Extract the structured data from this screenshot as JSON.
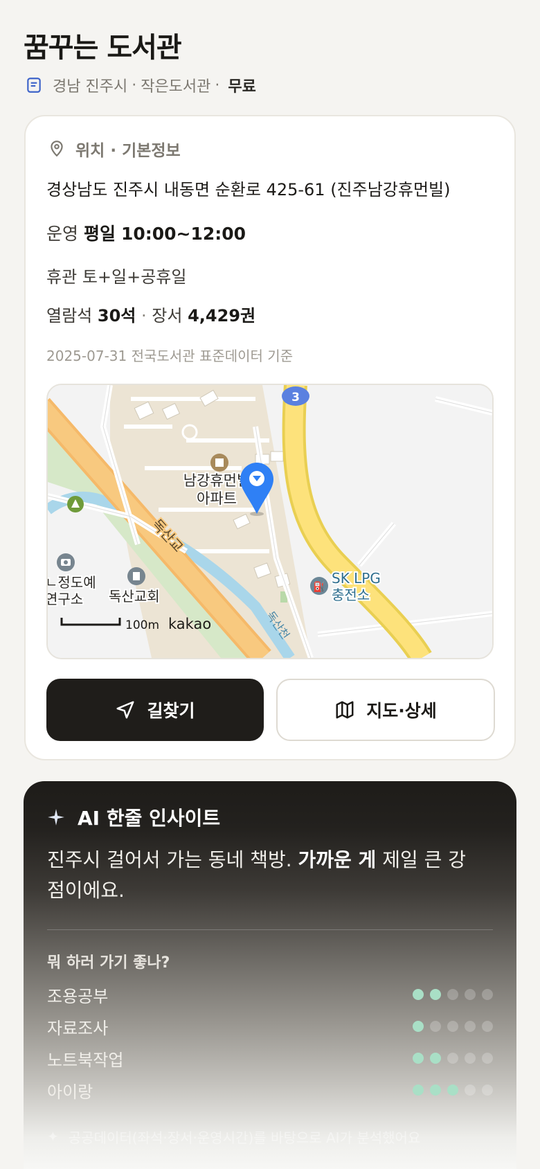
{
  "header": {
    "title": "꿈꾸는 도서관",
    "region": "경남 진주시",
    "type": "작은도서관",
    "fee": "무료",
    "separator": "·"
  },
  "info": {
    "section_title": "위치 · 기본정보",
    "address": "경상남도 진주시 내동면 순환로 425-61 (진주남강휴먼빌)",
    "hours_label": "운영",
    "hours_days": "평일",
    "hours_time": "10:00~12:00",
    "closed_label": "휴관",
    "closed_value": "토+일+공휴일",
    "seats_label": "열람석",
    "seats_value": "30석",
    "books_label": "장서",
    "books_value": "4,429권",
    "source": "2025-07-31 전국도서관 표준데이터 기준"
  },
  "map": {
    "poi_apartment_1": "남강휴먼빌",
    "poi_apartment_2": "아파트",
    "road_name": "독산교",
    "poi_gas_1": "SK LPG",
    "poi_gas_2": "충전소",
    "poi_church": "독산교회",
    "poi_institute_1": "ㄴ정도예",
    "poi_institute_2": "연구소",
    "road_shield": "3",
    "stream": "독산천",
    "scale": "100m",
    "brand": "kakao"
  },
  "actions": {
    "directions": "길찾기",
    "map_detail": "지도·상세"
  },
  "ai": {
    "title": "AI 한줄 인사이트",
    "text_before": "진주시 걸어서 가는 동네 책방. ",
    "text_bold": "가까운 게",
    "text_after": " 제일 큰 강점이에요.",
    "question": "뭐 하러 가기 좋나?",
    "activities": [
      {
        "label": "조용공부",
        "score": 2,
        "max": 5
      },
      {
        "label": "자료조사",
        "score": 1,
        "max": 5
      },
      {
        "label": "노트북작업",
        "score": 2,
        "max": 5
      },
      {
        "label": "아이랑",
        "score": 3,
        "max": 5
      }
    ],
    "footnote": "공공데이터(좌석·장서·운영시간)를 바탕으로 AI가 분석했어요"
  },
  "colors": {
    "background": "#f5f4f1",
    "primary_button": "#1f1d1a",
    "dot_active": "#a9dfc6",
    "map_pin": "#2f80f5"
  }
}
